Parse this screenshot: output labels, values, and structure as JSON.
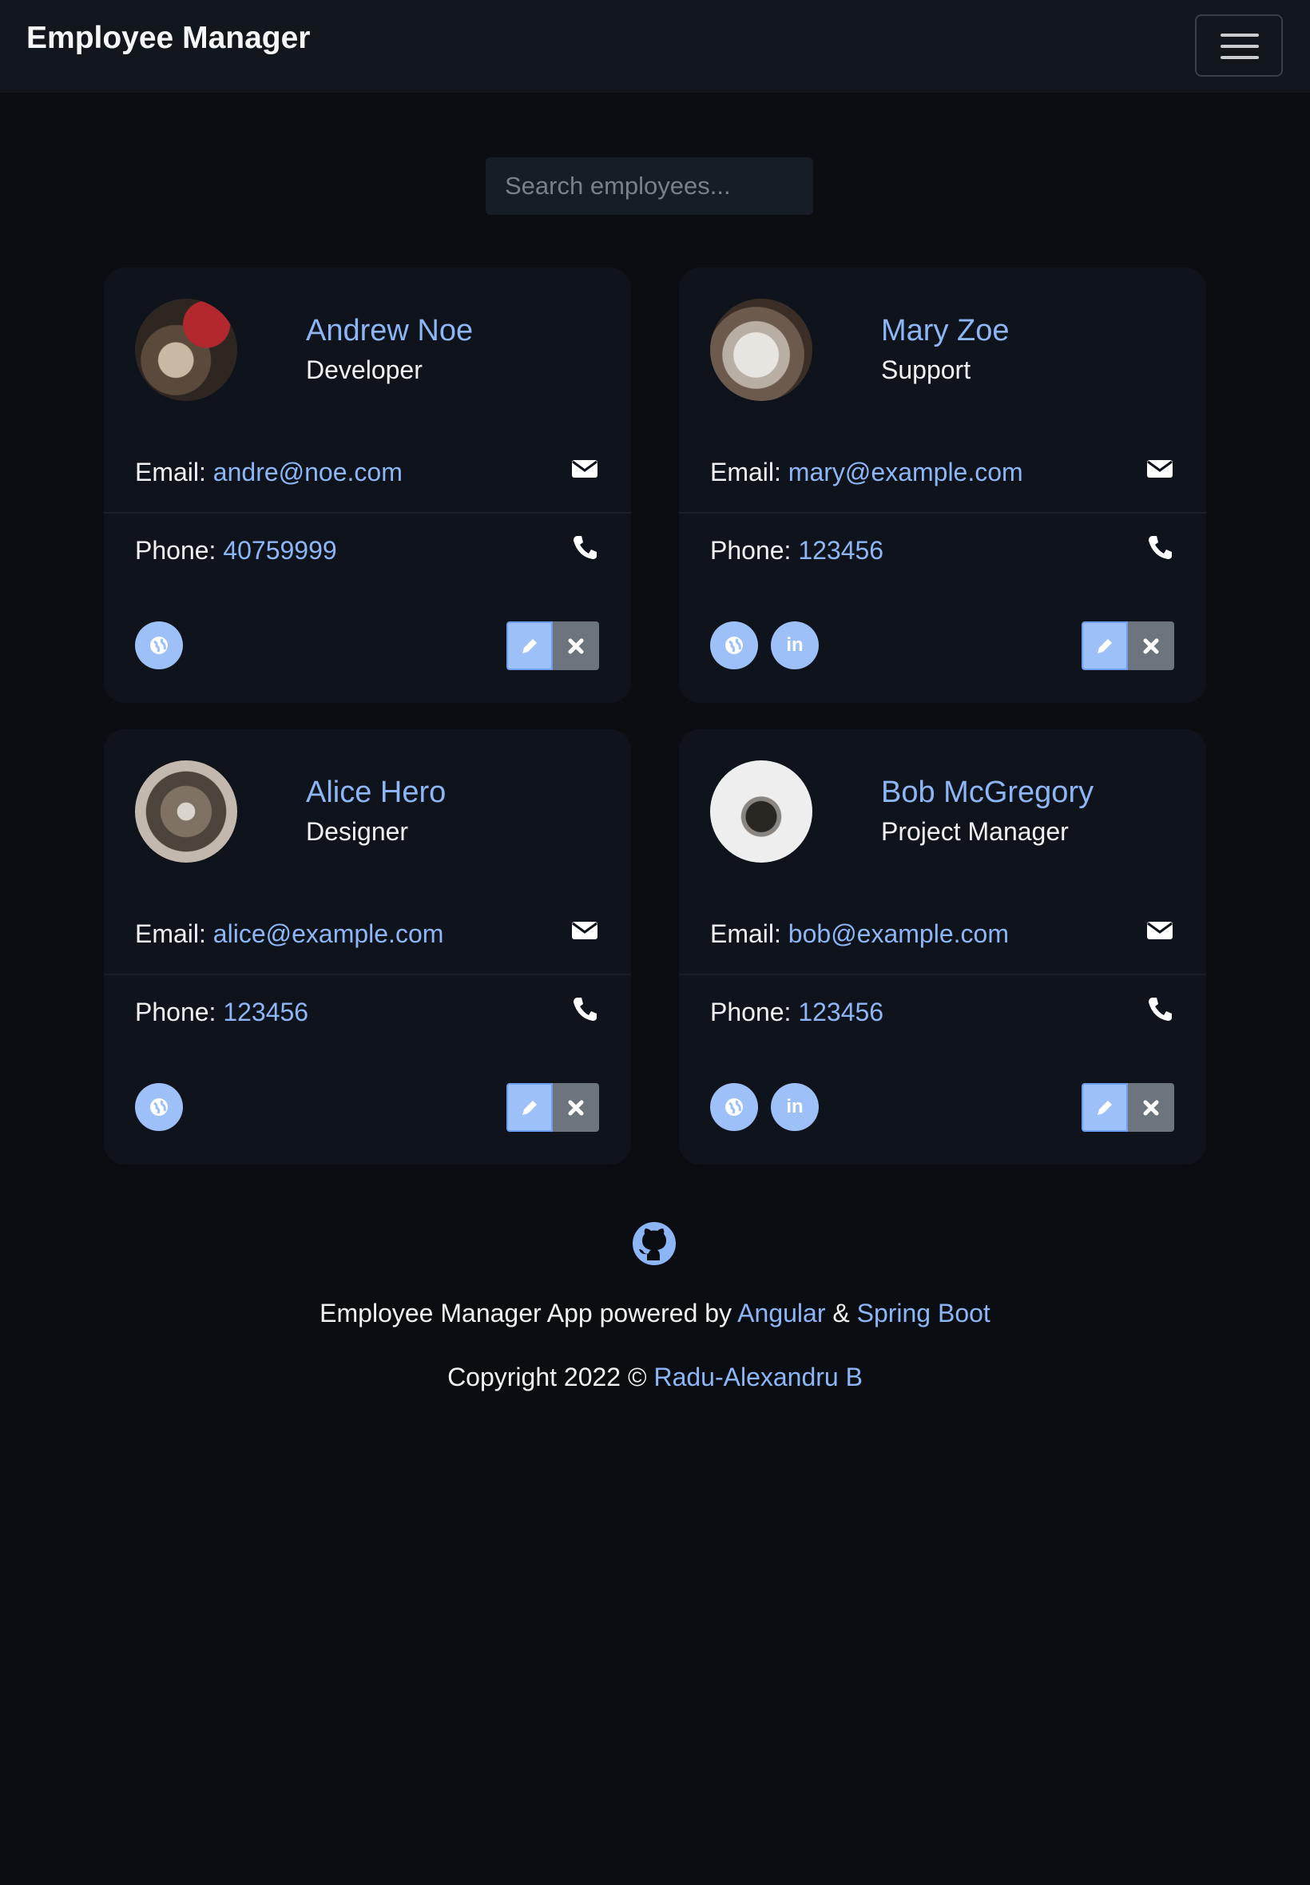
{
  "navbar": {
    "brand": "Employee Manager"
  },
  "search": {
    "placeholder": "Search employees..."
  },
  "labels": {
    "email": "Email: ",
    "phone": "Phone: "
  },
  "employees": [
    {
      "name": "Andrew Noe",
      "role": "Developer",
      "email": "andre@noe.com",
      "phone": "40759999",
      "linkedin": false
    },
    {
      "name": "Mary Zoe",
      "role": "Support",
      "email": "mary@example.com",
      "phone": "123456",
      "linkedin": true
    },
    {
      "name": "Alice Hero",
      "role": "Designer",
      "email": "alice@example.com",
      "phone": "123456",
      "linkedin": false
    },
    {
      "name": "Bob McGregory",
      "role": "Project Manager",
      "email": "bob@example.com",
      "phone": "123456",
      "linkedin": true
    }
  ],
  "footer": {
    "powered_prefix": "Employee Manager App powered by ",
    "angular": "Angular",
    "amp": " & ",
    "spring": "Spring Boot",
    "copyright_prefix": "Copyright 2022 © ",
    "author": "Radu-Alexandru B"
  },
  "colors": {
    "accent": "#8db6f6",
    "background": "#0a0e13",
    "card": "#0f141c"
  }
}
